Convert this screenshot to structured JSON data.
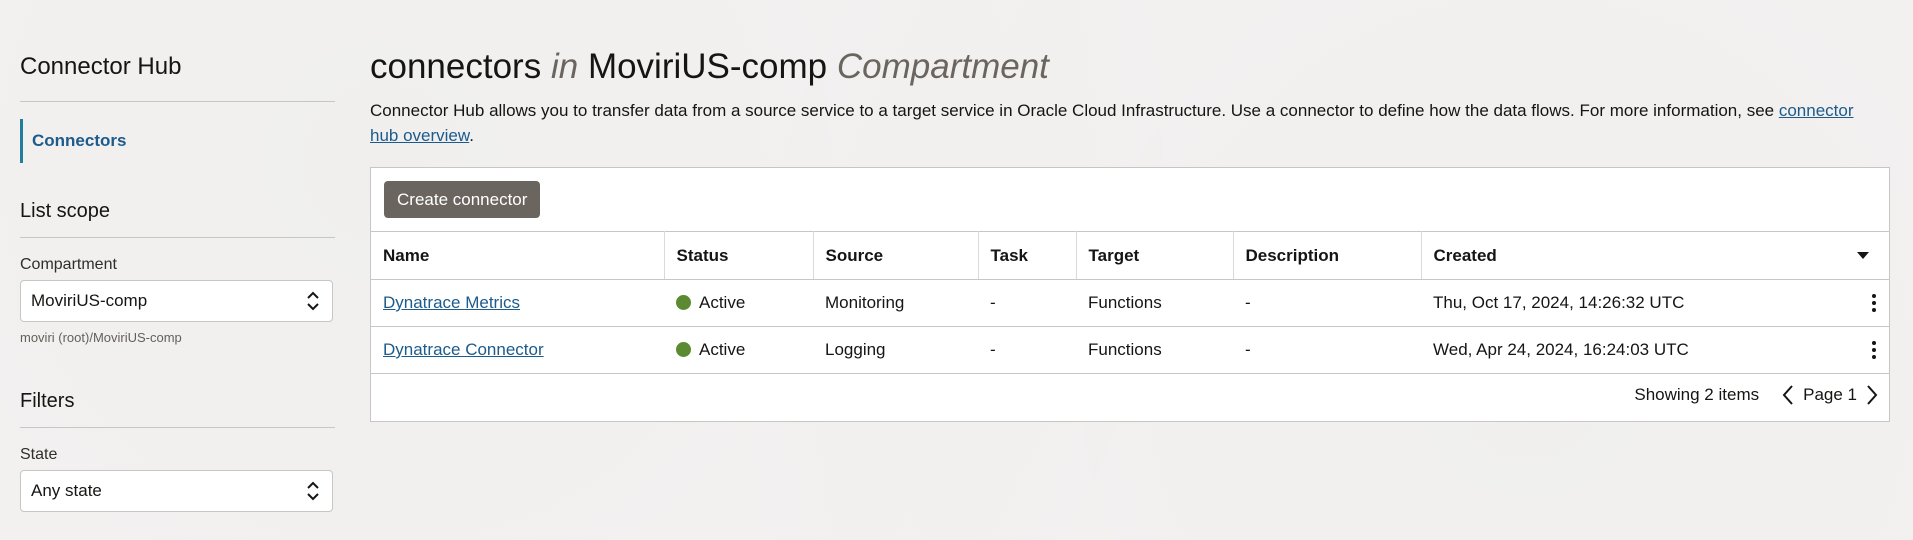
{
  "sidebar": {
    "title": "Connector Hub",
    "nav_item": "Connectors",
    "list_scope": {
      "title": "List scope",
      "label": "Compartment",
      "value": "MoviriUS-comp",
      "hint": "moviri (root)/MoviriUS-comp"
    },
    "filters": {
      "title": "Filters",
      "label": "State",
      "value": "Any state"
    }
  },
  "main": {
    "heading": {
      "part1": "connectors",
      "in": "in",
      "compartment": "MoviriUS-comp",
      "suffix": "Compartment"
    },
    "description": "Connector Hub allows you to transfer data from a source service to a target service in Oracle Cloud Infrastructure. Use a connector to define how the data flows. For more information, see ",
    "description_link": "connector hub overview",
    "description_end": ".",
    "create_button": "Create connector",
    "columns": [
      "Name",
      "Status",
      "Source",
      "Task",
      "Target",
      "Description",
      "Created"
    ],
    "rows": [
      {
        "name": "Dynatrace Metrics",
        "status": "Active",
        "source": "Monitoring",
        "task": "-",
        "target": "Functions",
        "description": "-",
        "created": "Thu, Oct 17, 2024, 14:26:32 UTC"
      },
      {
        "name": "Dynatrace Connector",
        "status": "Active",
        "source": "Logging",
        "task": "-",
        "target": "Functions",
        "description": "-",
        "created": "Wed, Apr 24, 2024, 16:24:03 UTC"
      }
    ],
    "footer": {
      "showing": "Showing 2 items",
      "page": "Page 1"
    }
  },
  "colors": {
    "link": "#1c5b8b",
    "accent": "#227e9e",
    "button": "#6b6560",
    "status_active": "#5c8a32"
  },
  "icons": [
    "chevron-up-down-icon",
    "sort-down-icon",
    "kebab-menu-icon",
    "chevron-left-icon",
    "chevron-right-icon"
  ]
}
